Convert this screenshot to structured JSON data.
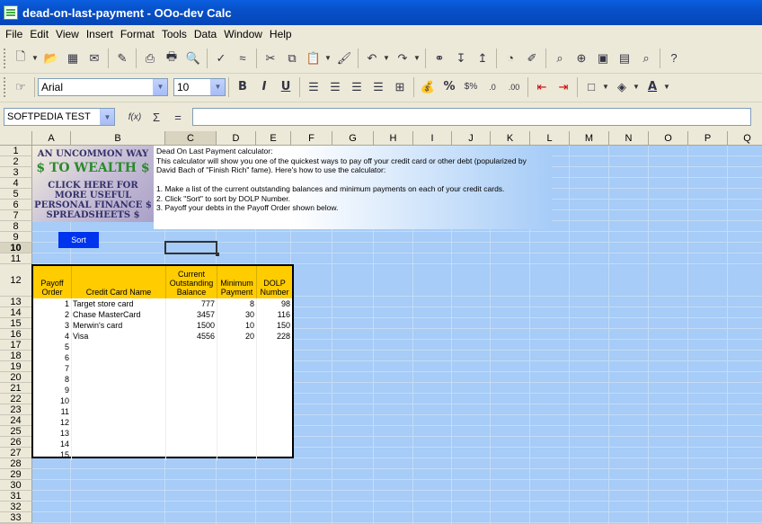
{
  "window": {
    "title": "dead-on-last-payment - OOo-dev Calc"
  },
  "menu": [
    "File",
    "Edit",
    "View",
    "Insert",
    "Format",
    "Tools",
    "Data",
    "Window",
    "Help"
  ],
  "toolbar2": {
    "font": "Arial",
    "size": "10"
  },
  "namebox": "SOFTPEDIA TEST",
  "formula_icons": {
    "function": "f(x)",
    "sum": "Σ",
    "equals": "="
  },
  "columns": [
    "A",
    "B",
    "C",
    "D",
    "E",
    "F",
    "G",
    "H",
    "I",
    "J",
    "K",
    "L",
    "M",
    "N",
    "O",
    "P",
    "Q"
  ],
  "rows": [
    "1",
    "2",
    "3",
    "4",
    "5",
    "6",
    "7",
    "8",
    "9",
    "10",
    "11",
    "12",
    "13",
    "14",
    "15",
    "16",
    "17",
    "18",
    "19",
    "20",
    "21",
    "22",
    "23",
    "24",
    "25",
    "26",
    "27",
    "28",
    "29",
    "30",
    "31",
    "32",
    "33"
  ],
  "banner": {
    "l1a": "AN UNCOMMON",
    "l1b": "WAY",
    "l2": "$ TO WEALTH $",
    "l3": "CLICK HERE FOR MORE USEFUL PERSONAL FINANCE $ SPREADSHEETS $"
  },
  "intro": [
    "Dead On Last Payment calculator:",
    "This calculator will show you one of the quickest ways to pay off your credit card or other debt (popularized by",
    "David Bach of \"Finish Rich\" fame).  Here's how to use the calculator:",
    "",
    "1. Make a list of the current outstanding balances and minimum payments on each of your credit cards.",
    "2. Click \"Sort\" to sort by DOLP Number.",
    "3. Payoff your debts in the Payoff Order shown below."
  ],
  "sort_label": "Sort",
  "table": {
    "headers": [
      "Payoff Order",
      "Credit Card Name",
      "Current Outstanding Balance",
      "Minimum Payment",
      "DOLP Number"
    ],
    "rows": [
      [
        "1",
        "Target store card",
        "777",
        "8",
        "98"
      ],
      [
        "2",
        "Chase MasterCard",
        "3457",
        "30",
        "116"
      ],
      [
        "3",
        "Merwin's card",
        "1500",
        "10",
        "150"
      ],
      [
        "4",
        "Visa",
        "4556",
        "20",
        "228"
      ],
      [
        "5",
        "",
        "",
        "",
        ""
      ],
      [
        "6",
        "",
        "",
        "",
        ""
      ],
      [
        "7",
        "",
        "",
        "",
        ""
      ],
      [
        "8",
        "",
        "",
        "",
        ""
      ],
      [
        "9",
        "",
        "",
        "",
        ""
      ],
      [
        "10",
        "",
        "",
        "",
        ""
      ],
      [
        "11",
        "",
        "",
        "",
        ""
      ],
      [
        "12",
        "",
        "",
        "",
        ""
      ],
      [
        "13",
        "",
        "",
        "",
        ""
      ],
      [
        "14",
        "",
        "",
        "",
        ""
      ],
      [
        "15",
        "",
        "",
        "",
        ""
      ]
    ]
  }
}
